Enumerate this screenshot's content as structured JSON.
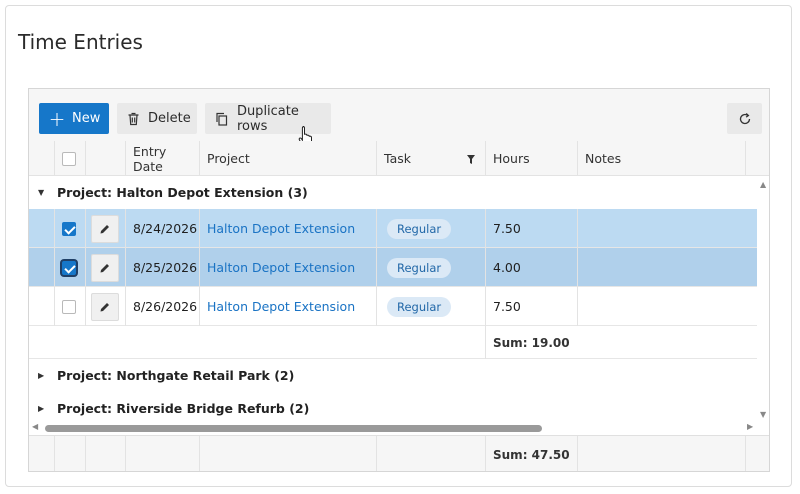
{
  "page": {
    "title": "Time Entries"
  },
  "toolbar": {
    "new_label": "New",
    "delete_label": "Delete",
    "duplicate_label": "Duplicate rows"
  },
  "columns": {
    "entry_date": "Entry Date",
    "project": "Project",
    "task": "Task",
    "hours": "Hours",
    "notes": "Notes"
  },
  "groups": [
    {
      "label": "Project: Halton Depot Extension (3)",
      "expanded": true,
      "rows": [
        {
          "entry_date": "8/24/2026",
          "project": "Halton Depot Extension",
          "task": "Regular",
          "hours": "7.50",
          "selected": true
        },
        {
          "entry_date": "8/25/2026",
          "project": "Halton Depot Extension",
          "task": "Regular",
          "hours": "4.00",
          "selected": true
        },
        {
          "entry_date": "8/26/2026",
          "project": "Halton Depot Extension",
          "task": "Regular",
          "hours": "7.50",
          "selected": false
        }
      ],
      "sum": "Sum: 19.00"
    },
    {
      "label": "Project: Northgate Retail Park (2)",
      "expanded": false
    },
    {
      "label": "Project: Riverside Bridge Refurb (2)",
      "expanded": false
    }
  ],
  "footer": {
    "total_sum": "Sum: 47.50"
  },
  "colors": {
    "accent": "#1677c9",
    "selected_row": "#bcdaf2",
    "link": "#1a73c4",
    "pill_bg": "#dbe9f6"
  },
  "icons": {
    "new": "plus-icon",
    "delete": "trash-icon",
    "duplicate": "copy-icon",
    "refresh": "refresh-icon",
    "edit": "pencil-icon",
    "filter": "filter-icon"
  }
}
